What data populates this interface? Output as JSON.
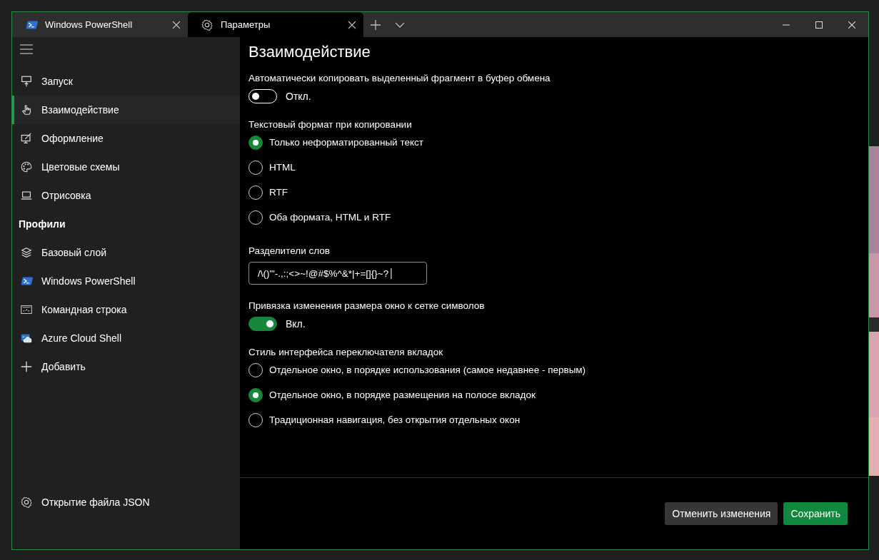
{
  "tabs": [
    {
      "kind": "powershell",
      "label": "Windows PowerShell",
      "selected": false
    },
    {
      "kind": "gear",
      "label": "Параметры",
      "selected": true
    }
  ],
  "sidebar": {
    "items": [
      {
        "kind": "launch",
        "label": "Запуск",
        "selected": false
      },
      {
        "kind": "hand",
        "label": "Взаимодействие",
        "selected": true
      },
      {
        "kind": "paint",
        "label": "Оформление",
        "selected": false
      },
      {
        "kind": "palette",
        "label": "Цветовые схемы",
        "selected": false
      },
      {
        "kind": "laptop",
        "label": "Отрисовка",
        "selected": false
      },
      {
        "kind": "header",
        "label": "Профили"
      },
      {
        "kind": "layers",
        "label": "Базовый слой",
        "selected": false
      },
      {
        "kind": "powershell",
        "label": "Windows PowerShell",
        "selected": false
      },
      {
        "kind": "cmd",
        "label": "Командная строка",
        "selected": false
      },
      {
        "kind": "azure",
        "label": "Azure Cloud Shell",
        "selected": false
      },
      {
        "kind": "plus",
        "label": "Добавить",
        "selected": false
      }
    ],
    "footer_item": {
      "kind": "gear",
      "label": "Открытие файла JSON"
    }
  },
  "content": {
    "title": "Взаимодействие",
    "settings": [
      {
        "kind": "toggle",
        "label": "Автоматически копировать выделенный фрагмент в буфер обмена",
        "on": false,
        "state_label": "Откл."
      },
      {
        "kind": "radio",
        "label": "Текстовый формат при копировании",
        "options": [
          {
            "label": "Только неформатированный текст",
            "selected": true
          },
          {
            "label": "HTML",
            "selected": false
          },
          {
            "label": "RTF",
            "selected": false
          },
          {
            "label": "Оба формата, HTML и RTF",
            "selected": false
          }
        ]
      },
      {
        "kind": "text",
        "label": "Разделители слов",
        "value": "/\\()\"'-.,:;<>~!@#$%^&*|+=[]{}~?│"
      },
      {
        "kind": "toggle",
        "label": "Привязка изменения размера окно к сетке символов",
        "on": true,
        "state_label": "Вкл."
      },
      {
        "kind": "radio",
        "label": "Стиль интерфейса переключателя вкладок",
        "options": [
          {
            "label": "Отдельное окно, в порядке использования (самое недавнее - первым)",
            "selected": false
          },
          {
            "label": "Отдельное окно, в порядке размещения на полосе вкладок",
            "selected": true
          },
          {
            "label": "Традиционная навигация, без открытия отдельных окон",
            "selected": false
          }
        ]
      }
    ]
  },
  "buttons": [
    {
      "kind": "secondary",
      "label": "Отменить изменения"
    },
    {
      "kind": "primary",
      "label": "Сохранить"
    }
  ]
}
